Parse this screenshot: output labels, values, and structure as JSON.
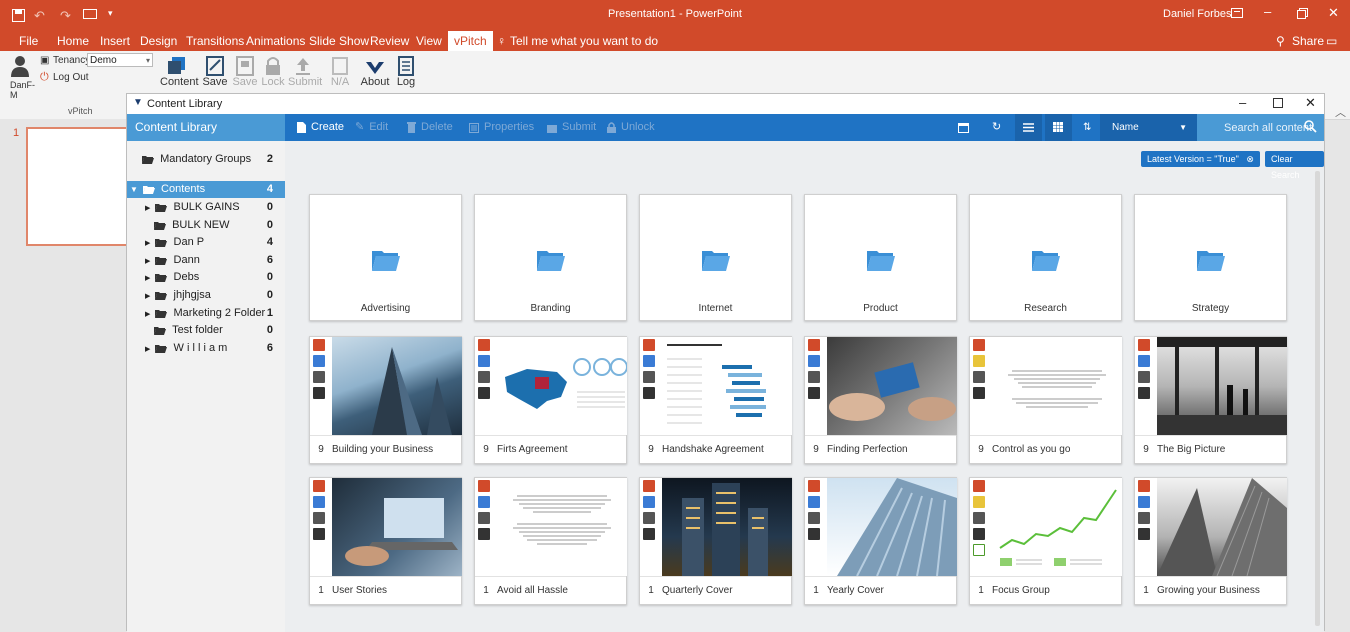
{
  "app": {
    "window_title": "Presentation1 - PowerPoint",
    "user": "Daniel Forbes"
  },
  "ribbon_tabs": [
    {
      "label": "File"
    },
    {
      "label": "Home"
    },
    {
      "label": "Insert"
    },
    {
      "label": "Design"
    },
    {
      "label": "Transitions"
    },
    {
      "label": "Animations"
    },
    {
      "label": "Slide Show"
    },
    {
      "label": "Review"
    },
    {
      "label": "View"
    },
    {
      "label": "vPitch"
    }
  ],
  "tell_me": "Tell me what you want to do",
  "share_label": "Share",
  "ribbon": {
    "tenancy_label": "Tenancy",
    "tenancy_value": "Demo",
    "logout_label": "Log Out",
    "user_short": "DanF-\nM",
    "group_label": "vPitch",
    "buttons": [
      {
        "label": "Content"
      },
      {
        "label": "Save"
      },
      {
        "label": "Save"
      },
      {
        "label": "Lock"
      },
      {
        "label": "Submit"
      },
      {
        "label": "N/A"
      },
      {
        "label": "About"
      },
      {
        "label": "Log"
      }
    ]
  },
  "slide_number": "1",
  "dialog": {
    "title": "Content Library",
    "side_header": "Content Library",
    "toolbar": {
      "create": "Create",
      "edit": "Edit",
      "delete": "Delete",
      "properties": "Properties",
      "submit": "Submit",
      "unlock": "Unlock",
      "sort_label": "Name",
      "search_placeholder": "Search all content"
    },
    "tree": [
      {
        "label": "Mandatory Groups",
        "count": "2"
      },
      {
        "label": "Contents",
        "count": "4"
      },
      {
        "label": "BULK GAINS",
        "count": "0"
      },
      {
        "label": "BULK NEW",
        "count": "0"
      },
      {
        "label": "Dan P",
        "count": "4"
      },
      {
        "label": "Dann",
        "count": "6"
      },
      {
        "label": "Debs",
        "count": "0"
      },
      {
        "label": "jhjhgjsa",
        "count": "0"
      },
      {
        "label": "Marketing 2 Folder",
        "count": "1"
      },
      {
        "label": "Test folder",
        "count": "0"
      },
      {
        "label": "W i l l i a m",
        "count": "6"
      }
    ],
    "filter_chip": "Latest Version = \"True\"",
    "clear_search": "Clear Search",
    "folders": [
      {
        "label": "Advertising"
      },
      {
        "label": "Branding"
      },
      {
        "label": "Internet"
      },
      {
        "label": "Product"
      },
      {
        "label": "Research"
      },
      {
        "label": "Strategy"
      }
    ],
    "contents": [
      {
        "num": "9",
        "label": "Building your Business"
      },
      {
        "num": "9",
        "label": "Firts Agreement"
      },
      {
        "num": "9",
        "label": "Handshake Agreement"
      },
      {
        "num": "9",
        "label": "Finding Perfection"
      },
      {
        "num": "9",
        "label": "Control as you go"
      },
      {
        "num": "9",
        "label": "The Big Picture"
      },
      {
        "num": "1",
        "label": "User Stories"
      },
      {
        "num": "1",
        "label": "Avoid all Hassle"
      },
      {
        "num": "1",
        "label": "Quarterly Cover"
      },
      {
        "num": "1",
        "label": "Yearly Cover"
      },
      {
        "num": "1",
        "label": "Focus Group"
      },
      {
        "num": "1",
        "label": "Growing your Business"
      }
    ]
  },
  "colors": {
    "ppt": "#d14a2a",
    "toolbar": "#1f73c4",
    "side": "#4a9ad5",
    "folder": "#3a8fd6"
  }
}
